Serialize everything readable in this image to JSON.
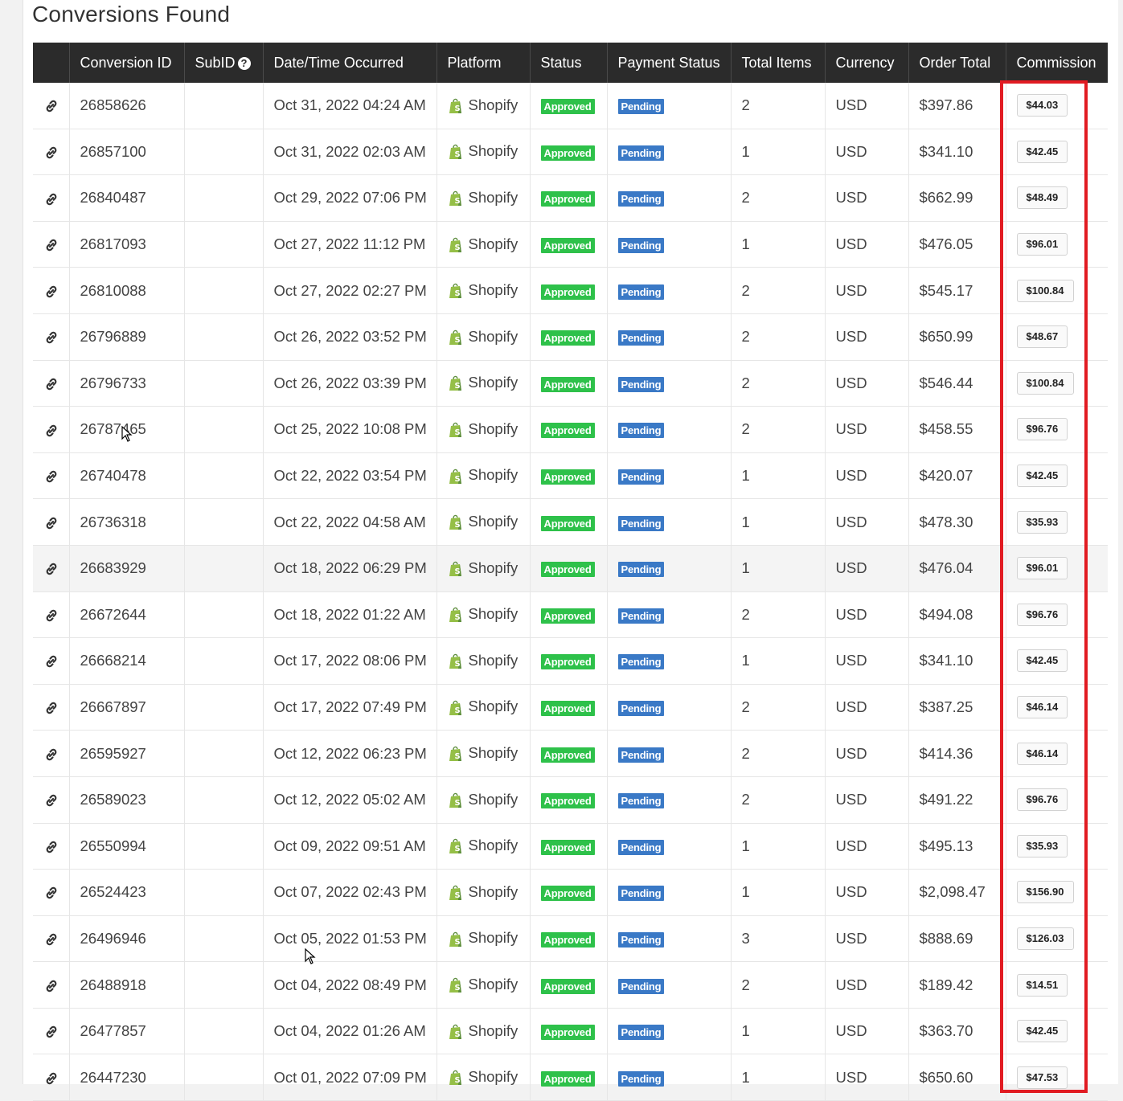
{
  "title": "Conversions Found",
  "columns": [
    "",
    "Conversion ID",
    "SubID",
    "Date/Time Occurred",
    "Platform",
    "Status",
    "Payment Status",
    "Total Items",
    "Currency",
    "Order Total",
    "Commission"
  ],
  "subid_help_icon": "question-circle-icon",
  "highlight_color": "#e11b22",
  "status_colors": {
    "approved": "#2ec14a",
    "pending": "#3a79c6"
  },
  "rows": [
    {
      "id": "26858626",
      "subid": "",
      "date": "Oct 31, 2022 04:24 AM",
      "platform": "Shopify",
      "status": "Approved",
      "payment": "Pending",
      "items": "2",
      "currency": "USD",
      "total": "$397.86",
      "commission": "$44.03"
    },
    {
      "id": "26857100",
      "subid": "",
      "date": "Oct 31, 2022 02:03 AM",
      "platform": "Shopify",
      "status": "Approved",
      "payment": "Pending",
      "items": "1",
      "currency": "USD",
      "total": "$341.10",
      "commission": "$42.45"
    },
    {
      "id": "26840487",
      "subid": "",
      "date": "Oct 29, 2022 07:06 PM",
      "platform": "Shopify",
      "status": "Approved",
      "payment": "Pending",
      "items": "2",
      "currency": "USD",
      "total": "$662.99",
      "commission": "$48.49"
    },
    {
      "id": "26817093",
      "subid": "",
      "date": "Oct 27, 2022 11:12 PM",
      "platform": "Shopify",
      "status": "Approved",
      "payment": "Pending",
      "items": "1",
      "currency": "USD",
      "total": "$476.05",
      "commission": "$96.01"
    },
    {
      "id": "26810088",
      "subid": "",
      "date": "Oct 27, 2022 02:27 PM",
      "platform": "Shopify",
      "status": "Approved",
      "payment": "Pending",
      "items": "2",
      "currency": "USD",
      "total": "$545.17",
      "commission": "$100.84"
    },
    {
      "id": "26796889",
      "subid": "",
      "date": "Oct 26, 2022 03:52 PM",
      "platform": "Shopify",
      "status": "Approved",
      "payment": "Pending",
      "items": "2",
      "currency": "USD",
      "total": "$650.99",
      "commission": "$48.67"
    },
    {
      "id": "26796733",
      "subid": "",
      "date": "Oct 26, 2022 03:39 PM",
      "platform": "Shopify",
      "status": "Approved",
      "payment": "Pending",
      "items": "2",
      "currency": "USD",
      "total": "$546.44",
      "commission": "$100.84"
    },
    {
      "id": "26787465",
      "subid": "",
      "date": "Oct 25, 2022 10:08 PM",
      "platform": "Shopify",
      "status": "Approved",
      "payment": "Pending",
      "items": "2",
      "currency": "USD",
      "total": "$458.55",
      "commission": "$96.76"
    },
    {
      "id": "26740478",
      "subid": "",
      "date": "Oct 22, 2022 03:54 PM",
      "platform": "Shopify",
      "status": "Approved",
      "payment": "Pending",
      "items": "1",
      "currency": "USD",
      "total": "$420.07",
      "commission": "$42.45"
    },
    {
      "id": "26736318",
      "subid": "",
      "date": "Oct 22, 2022 04:58 AM",
      "platform": "Shopify",
      "status": "Approved",
      "payment": "Pending",
      "items": "1",
      "currency": "USD",
      "total": "$478.30",
      "commission": "$35.93"
    },
    {
      "id": "26683929",
      "subid": "",
      "date": "Oct 18, 2022 06:29 PM",
      "platform": "Shopify",
      "status": "Approved",
      "payment": "Pending",
      "items": "1",
      "currency": "USD",
      "total": "$476.04",
      "commission": "$96.01"
    },
    {
      "id": "26672644",
      "subid": "",
      "date": "Oct 18, 2022 01:22 AM",
      "platform": "Shopify",
      "status": "Approved",
      "payment": "Pending",
      "items": "2",
      "currency": "USD",
      "total": "$494.08",
      "commission": "$96.76"
    },
    {
      "id": "26668214",
      "subid": "",
      "date": "Oct 17, 2022 08:06 PM",
      "platform": "Shopify",
      "status": "Approved",
      "payment": "Pending",
      "items": "1",
      "currency": "USD",
      "total": "$341.10",
      "commission": "$42.45"
    },
    {
      "id": "26667897",
      "subid": "",
      "date": "Oct 17, 2022 07:49 PM",
      "platform": "Shopify",
      "status": "Approved",
      "payment": "Pending",
      "items": "2",
      "currency": "USD",
      "total": "$387.25",
      "commission": "$46.14"
    },
    {
      "id": "26595927",
      "subid": "",
      "date": "Oct 12, 2022 06:23 PM",
      "platform": "Shopify",
      "status": "Approved",
      "payment": "Pending",
      "items": "2",
      "currency": "USD",
      "total": "$414.36",
      "commission": "$46.14"
    },
    {
      "id": "26589023",
      "subid": "",
      "date": "Oct 12, 2022 05:02 AM",
      "platform": "Shopify",
      "status": "Approved",
      "payment": "Pending",
      "items": "2",
      "currency": "USD",
      "total": "$491.22",
      "commission": "$96.76"
    },
    {
      "id": "26550994",
      "subid": "",
      "date": "Oct 09, 2022 09:51 AM",
      "platform": "Shopify",
      "status": "Approved",
      "payment": "Pending",
      "items": "1",
      "currency": "USD",
      "total": "$495.13",
      "commission": "$35.93"
    },
    {
      "id": "26524423",
      "subid": "",
      "date": "Oct 07, 2022 02:43 PM",
      "platform": "Shopify",
      "status": "Approved",
      "payment": "Pending",
      "items": "1",
      "currency": "USD",
      "total": "$2,098.47",
      "commission": "$156.90"
    },
    {
      "id": "26496946",
      "subid": "",
      "date": "Oct 05, 2022 01:53 PM",
      "platform": "Shopify",
      "status": "Approved",
      "payment": "Pending",
      "items": "3",
      "currency": "USD",
      "total": "$888.69",
      "commission": "$126.03"
    },
    {
      "id": "26488918",
      "subid": "",
      "date": "Oct 04, 2022 08:49 PM",
      "platform": "Shopify",
      "status": "Approved",
      "payment": "Pending",
      "items": "2",
      "currency": "USD",
      "total": "$189.42",
      "commission": "$14.51"
    },
    {
      "id": "26477857",
      "subid": "",
      "date": "Oct 04, 2022 01:26 AM",
      "platform": "Shopify",
      "status": "Approved",
      "payment": "Pending",
      "items": "1",
      "currency": "USD",
      "total": "$363.70",
      "commission": "$42.45"
    },
    {
      "id": "26447230",
      "subid": "",
      "date": "Oct 01, 2022 07:09 PM",
      "platform": "Shopify",
      "status": "Approved",
      "payment": "Pending",
      "items": "1",
      "currency": "USD",
      "total": "$650.60",
      "commission": "$47.53"
    }
  ]
}
